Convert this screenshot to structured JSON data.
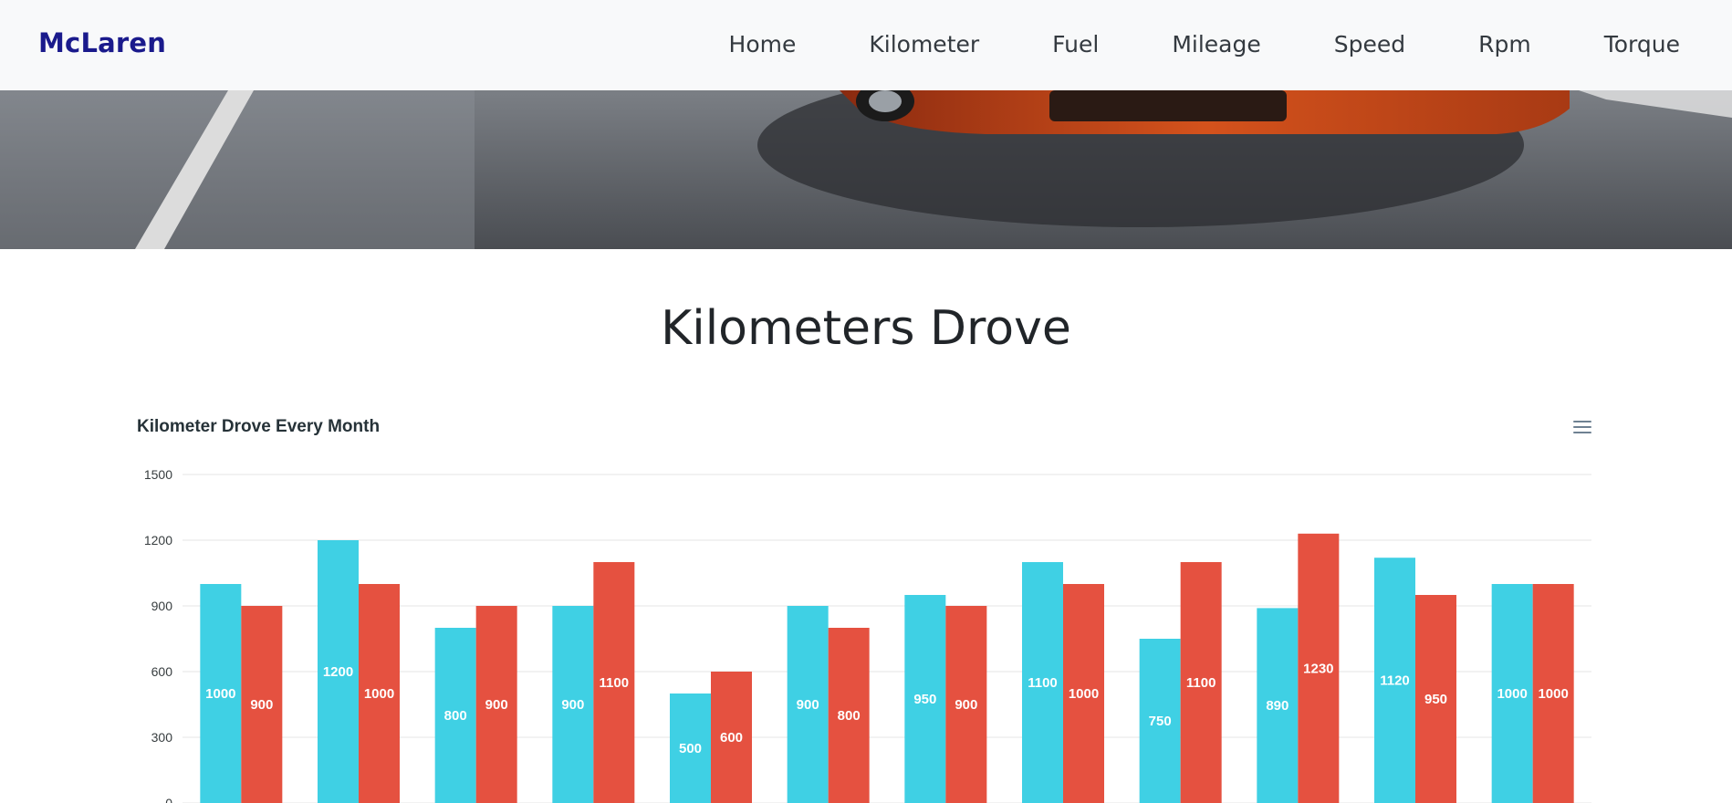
{
  "nav": {
    "brand": "McLaren",
    "links": [
      "Home",
      "Kilometer",
      "Fuel",
      "Mileage",
      "Speed",
      "Rpm",
      "Torque"
    ]
  },
  "page": {
    "heading": "Kilometers Drove"
  },
  "colors": {
    "series_a": "#3fd0e4",
    "series_b": "#e55140",
    "brand": "#1a1a8c"
  },
  "icons": {
    "chart_menu": "hamburger-menu-icon"
  },
  "chart_data": {
    "type": "bar",
    "title": "Kilometer Drove Every Month",
    "xlabel": "",
    "ylabel": "",
    "ylim": [
      0,
      1500
    ],
    "yticks": [
      0,
      300,
      600,
      900,
      1200,
      1500
    ],
    "grid": true,
    "categories": [
      "",
      "",
      "",
      "",
      "",
      "",
      "",
      "",
      "",
      "",
      "",
      ""
    ],
    "series": [
      {
        "values": [
          1000,
          1200,
          800,
          900,
          500,
          900,
          950,
          1100,
          750,
          890,
          1120,
          1000
        ]
      },
      {
        "values": [
          900,
          1000,
          900,
          1100,
          600,
          800,
          900,
          1000,
          1100,
          1230,
          950,
          1000
        ]
      }
    ]
  }
}
